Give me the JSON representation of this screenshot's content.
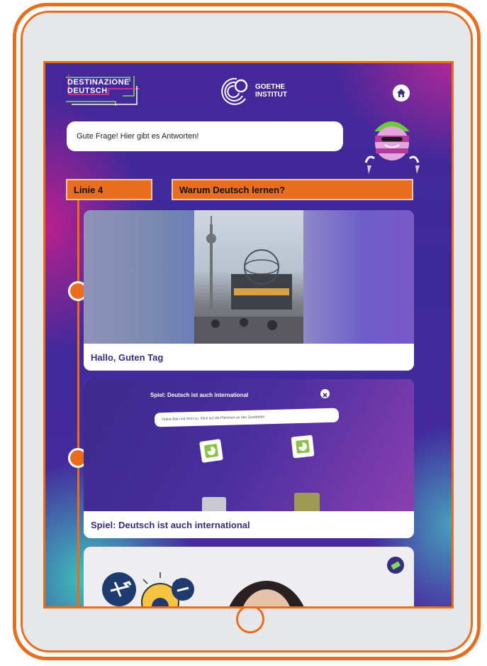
{
  "header": {
    "brand_line1": "DESTINAZIONE",
    "brand_line2": "DEUTSCH",
    "partner_line1": "GOETHE",
    "partner_line2": "INSTITUT",
    "home_icon": "home-icon"
  },
  "speech_bubble": {
    "text": "Gute Frage! Hier gibt es Antworten!"
  },
  "tags": {
    "line": "Linie 4",
    "topic": "Warum Deutsch lernen?"
  },
  "cards": [
    {
      "title": "Hallo, Guten Tag"
    },
    {
      "title": "Spiel: Deutsch ist auch international",
      "game_header": "Spiel: Deutsch ist auch international",
      "game_instruction": "Ordne Bild und Wort zu. Klick auf die Pfeilchen an den Quadraten."
    }
  ],
  "colors": {
    "accent": "#E96D1E",
    "title_text": "#3A2C80",
    "screen_bg": "#45279A"
  }
}
